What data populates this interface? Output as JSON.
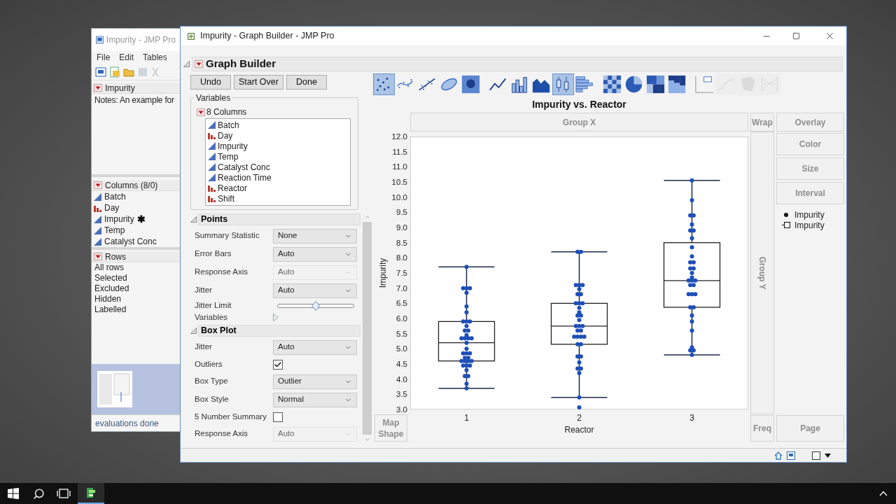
{
  "back_window": {
    "title": "Impurity - JMP Pro",
    "menu": [
      "File",
      "Edit",
      "Tables"
    ],
    "table_panel": {
      "title": "Impurity",
      "notes": "Notes:  An example for"
    },
    "columns_panel": {
      "title": "Columns (8/0)",
      "items": [
        {
          "name": "Batch",
          "kind": "continuous"
        },
        {
          "name": "Day",
          "kind": "nominal"
        },
        {
          "name": "Impurity",
          "kind": "continuous",
          "marker": "✱"
        },
        {
          "name": "Temp",
          "kind": "continuous"
        },
        {
          "name": "Catalyst Conc",
          "kind": "continuous"
        }
      ]
    },
    "rows_panel": {
      "title": "Rows",
      "items": [
        "All rows",
        "Selected",
        "Excluded",
        "Hidden",
        "Labelled"
      ]
    },
    "status": "evaluations done"
  },
  "main_window": {
    "title": "Impurity - Graph Builder - JMP Pro",
    "graph_builder": {
      "title": "Graph Builder",
      "buttons": [
        "Undo",
        "Start Over",
        "Done"
      ],
      "variables": {
        "label": "Variables",
        "group": "8 Columns",
        "columns": [
          {
            "name": "Batch",
            "kind": "continuous"
          },
          {
            "name": "Day",
            "kind": "nominal"
          },
          {
            "name": "Impurity",
            "kind": "continuous"
          },
          {
            "name": "Temp",
            "kind": "continuous"
          },
          {
            "name": "Catalyst Conc",
            "kind": "continuous"
          },
          {
            "name": "Reaction Time",
            "kind": "continuous"
          },
          {
            "name": "Reactor",
            "kind": "nominal"
          },
          {
            "name": "Shift",
            "kind": "nominal"
          }
        ]
      },
      "sections": [
        {
          "title": "Points",
          "rows": [
            {
              "kind": "select",
              "label": "Summary Statistic",
              "value": "None",
              "disabled": false
            },
            {
              "kind": "select",
              "label": "Error Bars",
              "value": "Auto",
              "disabled": false
            },
            {
              "kind": "select",
              "label": "Response Axis",
              "value": "Auto",
              "disabled": true
            },
            {
              "kind": "select",
              "label": "Jitter",
              "value": "Auto",
              "disabled": false
            },
            {
              "kind": "slider",
              "label": "Jitter Limit",
              "level": 0.5
            },
            {
              "kind": "expander",
              "label": "Variables"
            }
          ]
        },
        {
          "title": "Box Plot",
          "rows": [
            {
              "kind": "select",
              "label": "Jitter",
              "value": "Auto",
              "disabled": false
            },
            {
              "kind": "checkbox",
              "label": "Outliers",
              "checked": true
            },
            {
              "kind": "select",
              "label": "Box Type",
              "value": "Outlier",
              "disabled": false
            },
            {
              "kind": "select",
              "label": "Box Style",
              "value": "Normal",
              "disabled": false
            },
            {
              "kind": "checkbox",
              "label": "5 Number Summary",
              "checked": false
            },
            {
              "kind": "select",
              "label": "Response Axis",
              "value": "Auto",
              "disabled": true
            }
          ]
        }
      ],
      "element_icons": [
        {
          "kind": "points",
          "selected": true,
          "disabled": false
        },
        {
          "kind": "smoother",
          "selected": false,
          "disabled": false
        },
        {
          "kind": "line_of_fit",
          "selected": false,
          "disabled": false
        },
        {
          "kind": "ellipse",
          "selected": false,
          "disabled": false
        },
        {
          "kind": "contour",
          "selected": false,
          "disabled": false
        },
        {
          "kind": "line",
          "selected": false,
          "disabled": false
        },
        {
          "kind": "bar",
          "selected": false,
          "disabled": false
        },
        {
          "kind": "area",
          "selected": false,
          "disabled": false
        },
        {
          "kind": "box",
          "selected": true,
          "disabled": false
        },
        {
          "kind": "histogram",
          "selected": false,
          "disabled": false
        },
        {
          "kind": "heatmap",
          "selected": false,
          "disabled": false
        },
        {
          "kind": "pie",
          "selected": false,
          "disabled": false
        },
        {
          "kind": "treemap",
          "selected": false,
          "disabled": false
        },
        {
          "kind": "mosaic",
          "selected": false,
          "disabled": false
        },
        {
          "kind": "caption",
          "selected": false,
          "disabled": false
        },
        {
          "kind": "formula",
          "selected": false,
          "disabled": true
        },
        {
          "kind": "map",
          "selected": false,
          "disabled": true
        },
        {
          "kind": "parallel",
          "selected": false,
          "disabled": true
        }
      ],
      "zones": [
        {
          "kind": "group_x",
          "label": "Group X"
        },
        {
          "kind": "wrap",
          "label": "Wrap"
        },
        {
          "kind": "overlay",
          "label": "Overlay"
        },
        {
          "kind": "color_role",
          "label": "Color"
        },
        {
          "kind": "size_role",
          "label": "Size"
        },
        {
          "kind": "interval",
          "label": "Interval"
        },
        {
          "kind": "group_y",
          "label": "Group Y"
        },
        {
          "kind": "map_shape",
          "label": "Map Shape"
        },
        {
          "kind": "freq",
          "label": "Freq"
        },
        {
          "kind": "page",
          "label": "Page"
        }
      ],
      "legend": [
        {
          "kind": "box",
          "label": "Impurity"
        }
      ],
      "chart": {
        "chart_data": {
          "type": "scatter",
          "title": "Impurity vs. Reactor",
          "xlabel": "Reactor",
          "ylabel": "Impurity",
          "xlim": [
            0.5,
            3.5
          ],
          "xticks": [
            {
              "value": 1,
              "label": "1"
            },
            {
              "value": 2,
              "label": "2"
            },
            {
              "value": 3,
              "label": "3"
            }
          ],
          "ylim": [
            3,
            12
          ],
          "yticks": [
            {
              "value": 3,
              "label": "3.0"
            },
            {
              "value": 3.5,
              "label": "3.5"
            },
            {
              "value": 4,
              "label": "4.0"
            },
            {
              "value": 4.5,
              "label": "4.5"
            },
            {
              "value": 5,
              "label": "5.0"
            },
            {
              "value": 5.5,
              "label": "5.5"
            },
            {
              "value": 6,
              "label": "6.0"
            },
            {
              "value": 6.5,
              "label": "6.5"
            },
            {
              "value": 7,
              "label": "7.0"
            },
            {
              "value": 7.5,
              "label": "7.5"
            },
            {
              "value": 8,
              "label": "8.0"
            },
            {
              "value": 8.5,
              "label": "8.5"
            },
            {
              "value": 9,
              "label": "9.0"
            },
            {
              "value": 9.5,
              "label": "9.5"
            },
            {
              "value": 10,
              "label": "10.0"
            },
            {
              "value": 10.5,
              "label": "10.5"
            },
            {
              "value": 11,
              "label": "11.0"
            },
            {
              "value": 11.5,
              "label": "11.5"
            },
            {
              "value": 12,
              "label": "12.0"
            }
          ],
          "series": [
            {
              "name": "Impurity",
              "color": "#1e4fb8",
              "x": [
                1,
                0.97,
                1,
                1.03,
                1,
                1,
                1,
                0.97,
                1,
                1.03,
                1,
                0.985,
                1.015,
                1,
                0.955,
                0.985,
                1.015,
                1.045,
                1,
                1,
                0.97,
                1,
                1.03,
                0.985,
                1.015,
                0.955,
                0.985,
                1.015,
                1.045,
                0.97,
                1,
                1.03,
                1,
                0.985,
                1.015,
                1,
                1,
                1.985,
                2.015,
                1.97,
                2,
                2.03,
                2,
                1.985,
                2.015,
                1.97,
                2,
                2.03,
                2,
                2,
                1.985,
                2.015,
                2,
                1.97,
                2,
                2.03,
                1.985,
                2.015,
                1.955,
                1.985,
                2.015,
                2.045,
                1.985,
                2.015,
                1.985,
                2.015,
                2,
                1.985,
                2.015,
                2,
                2,
                2,
                3,
                3,
                2.985,
                3.015,
                3,
                2.985,
                3.015,
                3,
                3,
                3,
                2.985,
                3.015,
                2.985,
                3.015,
                3,
                3,
                2.97,
                3,
                3.03,
                2.985,
                3.015,
                2.97,
                3,
                3.03,
                2.985,
                3.015,
                3,
                3,
                3,
                3,
                2.985,
                3.015,
                3
              ],
              "values": [
                7.7,
                7,
                7,
                7,
                6.85,
                6.4,
                6.2,
                5.9,
                5.9,
                5.9,
                5.75,
                5.6,
                5.6,
                5.45,
                5.35,
                5.35,
                5.35,
                5.35,
                5.2,
                5,
                4.85,
                4.85,
                4.85,
                4.7,
                4.7,
                4.6,
                4.6,
                4.6,
                4.6,
                4.45,
                4.45,
                4.45,
                4.3,
                4.1,
                4.1,
                3.85,
                3.7,
                8.2,
                8.2,
                7.1,
                7.1,
                7.1,
                6.97,
                6.8,
                6.8,
                6.5,
                6.5,
                6.5,
                6.35,
                6.2,
                6.1,
                6.1,
                5.95,
                5.75,
                5.75,
                5.75,
                5.6,
                5.6,
                5.4,
                5.4,
                5.4,
                5.4,
                5.15,
                5.15,
                4.75,
                4.75,
                4.55,
                4.35,
                4.35,
                4.2,
                3.4,
                3.07,
                10.55,
                9.9,
                9.4,
                9.4,
                9.1,
                8.9,
                8.9,
                8.65,
                8.35,
                8.05,
                7.85,
                7.85,
                7.65,
                7.65,
                7.5,
                7.35,
                7.25,
                7.25,
                7.25,
                7.1,
                7.1,
                6.8,
                6.8,
                6.8,
                6.37,
                6.37,
                6.1,
                5.9,
                5.6,
                5.05,
                4.95,
                4.95,
                4.8
              ]
            }
          ]
        }
      }
    }
  }
}
